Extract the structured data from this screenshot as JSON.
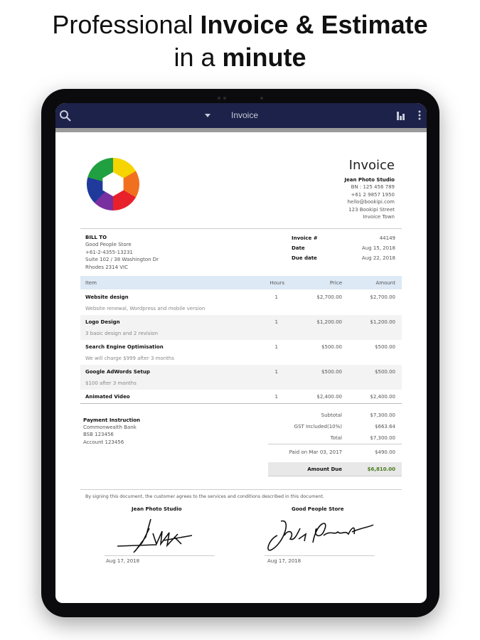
{
  "headline": {
    "line1_regular": "Professional ",
    "line1_bold": "Invoice & Estimate",
    "line2_regular": "in a ",
    "line2_bold": "minute"
  },
  "toolbar": {
    "title": "Invoice",
    "icons": [
      "search-icon",
      "dropdown-icon",
      "chart-icon",
      "more-icon"
    ]
  },
  "invoice": {
    "title": "Invoice",
    "company": {
      "name": "Jean Photo Studio",
      "bn": "BN : 125 456 789",
      "phone": "+61 2 9857 1950",
      "email": "hello@bookipi.com",
      "street": "123 Bookipi Street",
      "town": "Invoice Town"
    },
    "bill_to": {
      "label": "BILL TO",
      "name": "Good People Store",
      "phone": "+61-2-4355-13231",
      "address1": "Suite 102 / 38 Washington Dr",
      "address2": "Rhodes 2314 VIC"
    },
    "meta": [
      {
        "label": "Invoice #",
        "value": "44149"
      },
      {
        "label": "Date",
        "value": "Aug 15, 2018"
      },
      {
        "label": "Due date",
        "value": "Aug 22, 2018"
      }
    ],
    "columns": [
      "Item",
      "Hours",
      "Price",
      "Amount"
    ],
    "items": [
      {
        "name": "Website design",
        "desc": "Website renewal, Wordpress and mobile version",
        "hours": "1",
        "price": "$2,700.00",
        "amount": "$2,700.00"
      },
      {
        "name": "Logo Design",
        "desc": "3 basic design and 2 revision",
        "hours": "1",
        "price": "$1,200.00",
        "amount": "$1,200.00"
      },
      {
        "name": "Search Engine Optimisation",
        "desc": "We will charge $999 after 3 months",
        "hours": "1",
        "price": "$500.00",
        "amount": "$500.00"
      },
      {
        "name": "Google AdWords Setup",
        "desc": "$100 after 3 months",
        "hours": "1",
        "price": "$500.00",
        "amount": "$500.00"
      },
      {
        "name": "Animated Video",
        "desc": "",
        "hours": "1",
        "price": "$2,400.00",
        "amount": "$2,400.00"
      }
    ],
    "payment": {
      "label": "Payment Instruction",
      "bank": "Commonwealth Bank",
      "bsb": "BSB 123456",
      "account": "Account 123456"
    },
    "totals": [
      {
        "label": "Subtotal",
        "value": "$7,300.00"
      },
      {
        "label": "GST Included(10%)",
        "value": "$663.64"
      },
      {
        "label": "Total",
        "value": "$7,300.00"
      }
    ],
    "paid": {
      "label": "Paid on Mar 03, 2017",
      "value": "$490.00"
    },
    "amount_due": {
      "label": "Amount Due",
      "value": "$6,810.00"
    },
    "disclaimer": "By signing this document, the customer agrees to the services and conditions described in this document.",
    "signatures": [
      {
        "name": "Jean Photo Studio",
        "date": "Aug 17, 2018"
      },
      {
        "name": "Good People Store",
        "date": "Aug 17, 2018"
      }
    ]
  },
  "colors": {
    "toolbar": "#1c2249",
    "table_header": "#dde9f5",
    "amount_due": "#4a7a1e"
  }
}
